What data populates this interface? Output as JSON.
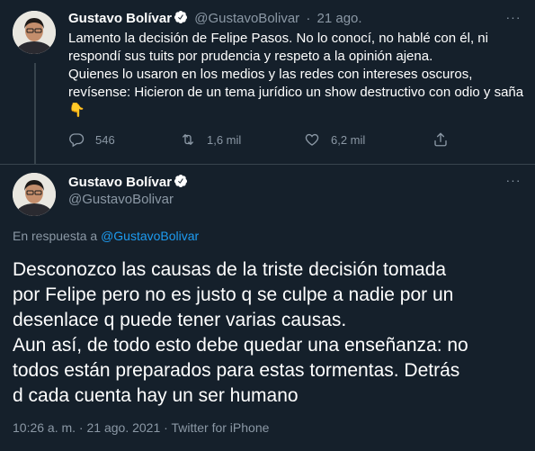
{
  "tweet1": {
    "display_name": "Gustavo Bolívar",
    "handle": "@GustavoBolivar",
    "separator": "·",
    "date": "21 ago.",
    "lines": [
      "Lamento la decisión de Felipe Pasos. No lo conocí, no hablé con él, ni",
      "respondí sus tuits por prudencia y respeto a la opinión ajena.",
      "Quienes lo usaron en los medios y las redes con intereses oscuros,",
      "revísense: Hicieron de un tema jurídico un show destructivo con odio y saña"
    ],
    "emoji": "👇",
    "replies": "546",
    "retweets": "1,6 mil",
    "likes": "6,2 mil",
    "more": "···"
  },
  "tweet2": {
    "display_name": "Gustavo Bolívar",
    "handle": "@GustavoBolivar",
    "more": "···",
    "reply_prefix": "En respuesta a ",
    "reply_handle": "@GustavoBolivar",
    "lines": [
      "Desconozco las causas de la triste decisión tomada",
      "por Felipe pero no es justo q se culpe a nadie por un",
      "desenlace q puede tener varias causas.",
      "Aun así, de todo esto debe quedar una enseñanza: no",
      "todos están preparados para estas tormentas. Detrás",
      "d cada cuenta hay un ser humano"
    ],
    "time": "10:26 a. m.",
    "sep1": " · ",
    "date": "21 ago. 2021",
    "sep2": " · ",
    "source": "Twitter for iPhone"
  },
  "colors": {
    "background": "#15202b",
    "text": "#ffffff",
    "muted": "#8b98a5",
    "accent": "#1d9bf0",
    "divider": "#38444d"
  },
  "icons": [
    "verified-badge-icon",
    "more-icon",
    "reply-icon",
    "retweet-icon",
    "like-icon",
    "share-icon"
  ]
}
